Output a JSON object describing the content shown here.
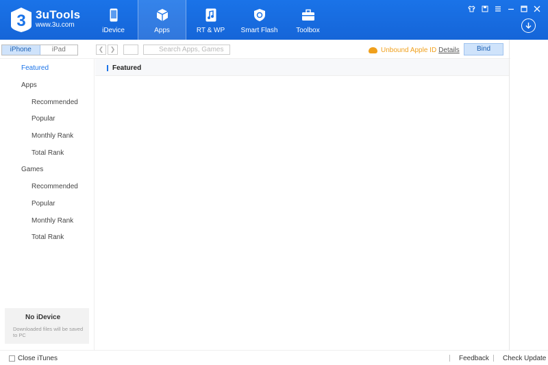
{
  "brand": {
    "name": "3uTools",
    "url": "www.3u.com",
    "logo_glyph": "3"
  },
  "nav": [
    {
      "label": "iDevice",
      "icon": "phone-icon"
    },
    {
      "label": "Apps",
      "icon": "cube-icon"
    },
    {
      "label": "RT & WP",
      "icon": "music-icon"
    },
    {
      "label": "Smart Flash",
      "icon": "shield-icon"
    },
    {
      "label": "Toolbox",
      "icon": "toolbox-icon"
    }
  ],
  "toolbar": {
    "device_tabs": [
      "iPhone",
      "iPad"
    ],
    "search_placeholder": "Search Apps, Games",
    "apple_id_status": "Unbound Apple ID",
    "details_link": "Details",
    "bind_label": "Bind"
  },
  "sidebar": {
    "featured": "Featured",
    "apps_header": "Apps",
    "apps_items": [
      "Recommended",
      "Popular",
      "Monthly Rank",
      "Total Rank"
    ],
    "games_header": "Games",
    "games_items": [
      "Recommended",
      "Popular",
      "Monthly Rank",
      "Total Rank"
    ],
    "no_device_title": "No iDevice",
    "no_device_desc": "Downloaded files will be saved to PC"
  },
  "content": {
    "title": "Featured"
  },
  "footer": {
    "close_itunes": "Close iTunes",
    "feedback": "Feedback",
    "check_update": "Check Update"
  },
  "colors": {
    "header_blue": "#1a73e8",
    "accent_orange": "#f0a01c",
    "selected_bg": "#cfe3fb"
  }
}
